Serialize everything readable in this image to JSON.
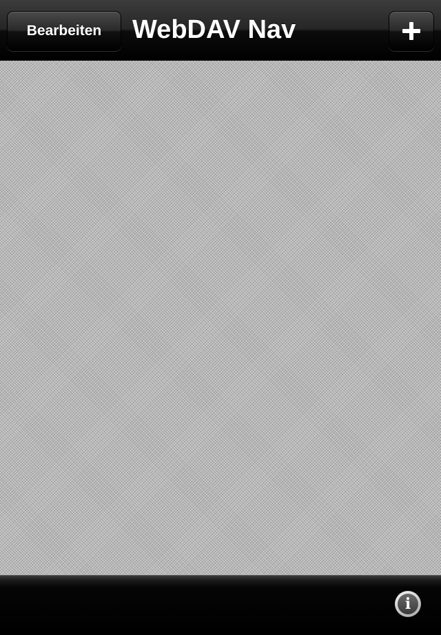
{
  "navbar": {
    "title": "WebDAV Nav",
    "edit_label": "Bearbeiten",
    "add_icon": "plus-icon"
  },
  "toolbar": {
    "info_icon": "info-icon",
    "info_glyph": "i"
  },
  "colors": {
    "bar_dark": "#000000",
    "content_bg": "#b8b8b8",
    "text": "#ffffff"
  }
}
